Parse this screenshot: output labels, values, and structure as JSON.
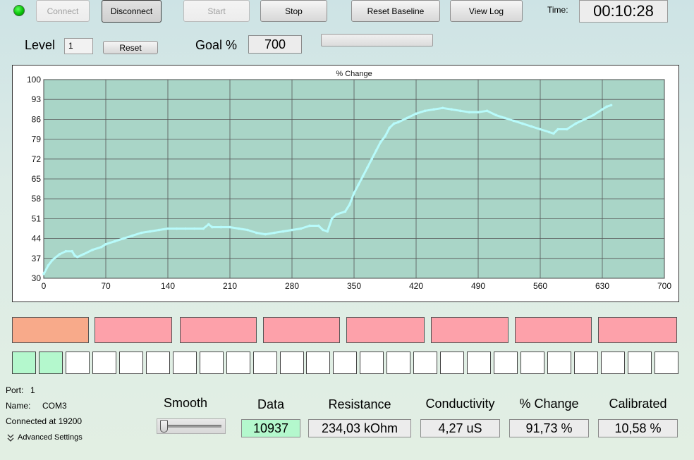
{
  "toolbar": {
    "connect_label": "Connect",
    "disconnect_label": "Disconnect",
    "start_label": "Start",
    "stop_label": "Stop",
    "reset_baseline_label": "Reset Baseline",
    "view_log_label": "View Log",
    "time_label": "Time:",
    "time_value": "00:10:28",
    "status_color": "#09c409"
  },
  "level": {
    "label": "Level",
    "value": "1",
    "reset_label": "Reset"
  },
  "goal": {
    "label": "Goal %",
    "value": "700",
    "progress_fraction": 0.0
  },
  "chart_data": {
    "type": "line",
    "title": "% Change",
    "xlabel": "",
    "ylabel": "",
    "xlim": [
      0,
      700
    ],
    "ylim": [
      30,
      100
    ],
    "xticks": [
      0,
      70,
      140,
      210,
      280,
      350,
      420,
      490,
      560,
      630,
      700
    ],
    "yticks": [
      30,
      37,
      44,
      51,
      58,
      65,
      72,
      79,
      86,
      93,
      100
    ],
    "grid": true,
    "line_color": "#b8fbfb",
    "plot_background": "#a9d5c7",
    "series": [
      {
        "x": [
          0,
          5,
          10,
          18,
          25,
          32,
          35,
          38,
          45,
          55,
          65,
          70,
          80,
          90,
          100,
          110,
          120,
          130,
          140,
          150,
          160,
          170,
          180,
          186,
          190,
          200,
          210,
          220,
          230,
          240,
          250,
          260,
          270,
          280,
          290,
          300,
          310,
          315,
          320,
          325,
          330,
          340,
          345,
          350,
          355,
          360,
          365,
          370,
          375,
          380,
          385,
          390,
          395,
          400,
          410,
          420,
          430,
          440,
          450,
          460,
          470,
          480,
          490,
          500,
          510,
          520,
          530,
          540,
          550,
          560,
          570,
          575,
          580,
          590,
          600,
          610,
          620,
          630,
          635,
          640
        ],
        "y": [
          31.5,
          34.5,
          36.5,
          38.5,
          39.5,
          39.5,
          38,
          37.5,
          38.5,
          40,
          41,
          42,
          43,
          44,
          45,
          46,
          46.5,
          47,
          47.5,
          47.5,
          47.5,
          47.5,
          47.5,
          49,
          48,
          48,
          48,
          47.5,
          47,
          46,
          45.5,
          46,
          46.5,
          47,
          47.5,
          48.5,
          48.5,
          47,
          46.5,
          51,
          52.5,
          53.5,
          56,
          60,
          63,
          66,
          69,
          72,
          75,
          78,
          80,
          83,
          84.5,
          85,
          86.5,
          88,
          89,
          89.5,
          90,
          89.5,
          89,
          88.5,
          88.5,
          89,
          87.5,
          86.5,
          85.5,
          84.5,
          83.5,
          82.5,
          81.5,
          81,
          82.5,
          82.5,
          84.5,
          86,
          87.5,
          89.5,
          90.5,
          91
        ]
      }
    ]
  },
  "status_boxes": {
    "colors": [
      "#f8aa8a",
      "#fda1aa",
      "#fda1aa",
      "#fda1aa",
      "#fda1aa",
      "#fda1aa",
      "#fda1aa",
      "#fda1aa"
    ]
  },
  "progress_squares": {
    "total": 25,
    "filled": 2,
    "filled_color": "#b4f8cd"
  },
  "port": {
    "port_label": "Port:",
    "port_value": "1",
    "name_label": "Name:",
    "name_value": "COM3",
    "connected_text": "Connected at 19200",
    "advanced_label": "Advanced Settings"
  },
  "readouts": {
    "smooth_label": "Smooth",
    "data_label": "Data",
    "data_value": "10937",
    "data_color": "#b4f8cd",
    "resistance_label": "Resistance",
    "resistance_value": "234,03 kOhm",
    "conductivity_label": "Conductivity",
    "conductivity_value": "4,27 uS",
    "change_label": "% Change",
    "change_value": "91,73 %",
    "calibrated_label": "Calibrated",
    "calibrated_value": "10,58 %",
    "smooth_level": 0.0
  }
}
